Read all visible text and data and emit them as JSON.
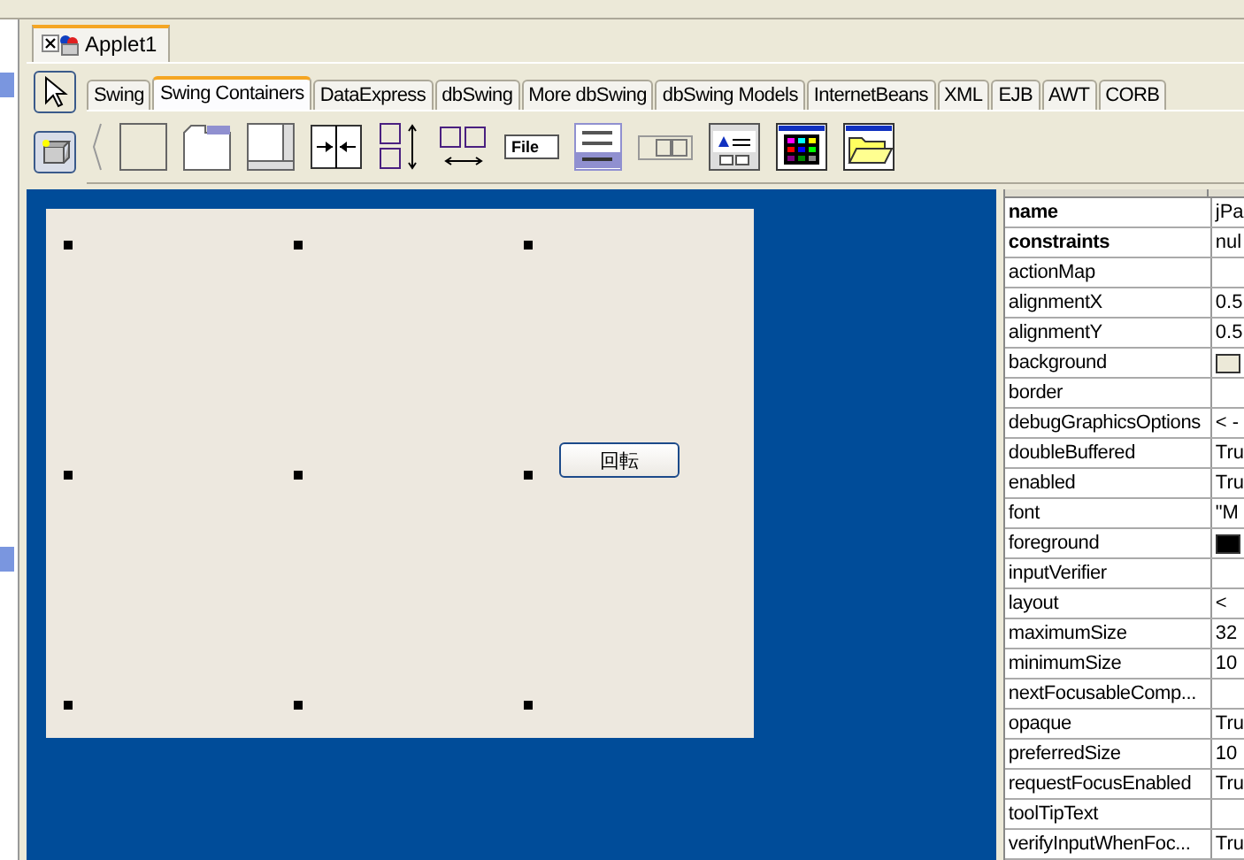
{
  "document_tab": {
    "label": "Applet1",
    "selected": true
  },
  "palette": {
    "tabs": [
      {
        "label": "Swing",
        "selected": false
      },
      {
        "label": "Swing Containers",
        "selected": true
      },
      {
        "label": "DataExpress",
        "selected": false
      },
      {
        "label": "dbSwing",
        "selected": false
      },
      {
        "label": "More dbSwing",
        "selected": false
      },
      {
        "label": "dbSwing Models",
        "selected": false
      },
      {
        "label": "InternetBeans",
        "selected": false
      },
      {
        "label": "XML",
        "selected": false
      },
      {
        "label": "EJB",
        "selected": false
      },
      {
        "label": "AWT",
        "selected": false
      },
      {
        "label": "CORB",
        "selected": false
      }
    ],
    "menu_icon_label": "File"
  },
  "designer": {
    "button_label": "回転"
  },
  "inspector": {
    "rows": [
      {
        "name": "name",
        "emphasized": true,
        "kind": "text",
        "value": "jPa"
      },
      {
        "name": "constraints",
        "emphasized": true,
        "kind": "text",
        "value": "nul"
      },
      {
        "name": "actionMap",
        "emphasized": false,
        "kind": "text",
        "value": ""
      },
      {
        "name": "alignmentX",
        "emphasized": false,
        "kind": "text",
        "value": "0.5"
      },
      {
        "name": "alignmentY",
        "emphasized": false,
        "kind": "text",
        "value": "0.5"
      },
      {
        "name": "background",
        "emphasized": false,
        "kind": "color",
        "color": "#ece9d8"
      },
      {
        "name": "border",
        "emphasized": false,
        "kind": "text",
        "value": ""
      },
      {
        "name": "debugGraphicsOptions",
        "emphasized": false,
        "kind": "text",
        "value": "< -"
      },
      {
        "name": "doubleBuffered",
        "emphasized": false,
        "kind": "text",
        "value": "Tru"
      },
      {
        "name": "enabled",
        "emphasized": false,
        "kind": "text",
        "value": "Tru"
      },
      {
        "name": "font",
        "emphasized": false,
        "kind": "text",
        "value": "\"M"
      },
      {
        "name": "foreground",
        "emphasized": false,
        "kind": "color",
        "color": "#000000"
      },
      {
        "name": "inputVerifier",
        "emphasized": false,
        "kind": "text",
        "value": ""
      },
      {
        "name": "layout",
        "emphasized": false,
        "kind": "text",
        "value": "<"
      },
      {
        "name": "maximumSize",
        "emphasized": false,
        "kind": "text",
        "value": "32"
      },
      {
        "name": "minimumSize",
        "emphasized": false,
        "kind": "text",
        "value": "10"
      },
      {
        "name": "nextFocusableComp...",
        "emphasized": false,
        "kind": "text",
        "value": ""
      },
      {
        "name": "opaque",
        "emphasized": false,
        "kind": "text",
        "value": "Tru"
      },
      {
        "name": "preferredSize",
        "emphasized": false,
        "kind": "text",
        "value": "10"
      },
      {
        "name": "requestFocusEnabled",
        "emphasized": false,
        "kind": "text",
        "value": "Tru"
      },
      {
        "name": "toolTipText",
        "emphasized": false,
        "kind": "text",
        "value": ""
      },
      {
        "name": "verifyInputWhenFoc...",
        "emphasized": false,
        "kind": "text",
        "value": "Tru"
      }
    ]
  }
}
